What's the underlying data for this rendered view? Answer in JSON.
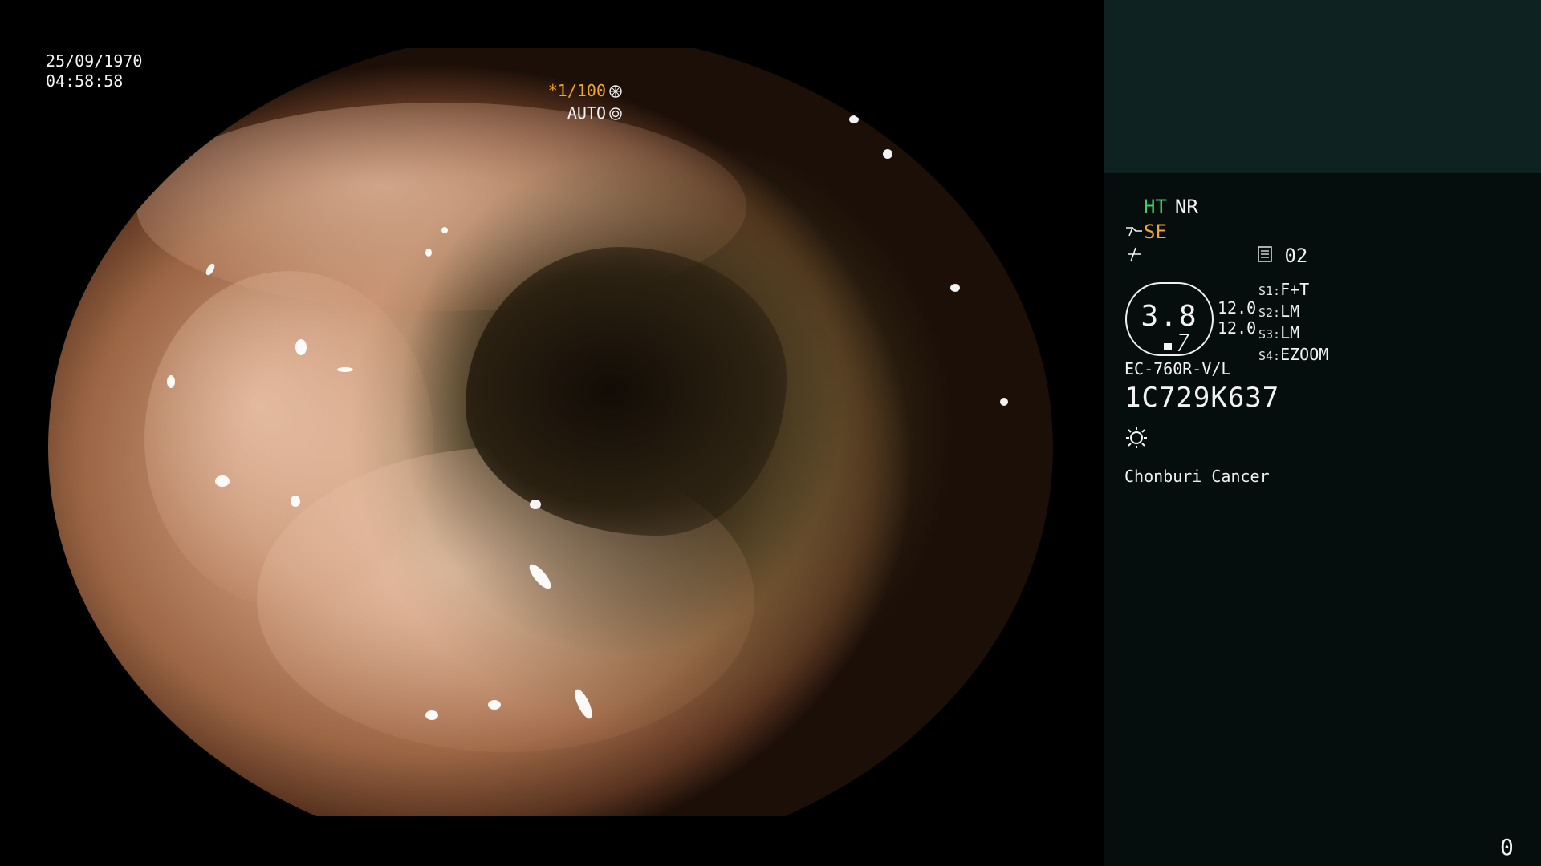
{
  "overlay": {
    "date": "25/09/1970",
    "time": "04:58:58",
    "shutter_speed": "*1/100",
    "shutter_mode": "AUTO"
  },
  "panel": {
    "ht_label": "HT",
    "nr_label": "NR",
    "se_label": "SE",
    "preset_number": "02",
    "gauge_value": "3.8",
    "values": [
      "12.0",
      "12.0"
    ],
    "switches": [
      {
        "key": "S1:",
        "value": "F+T"
      },
      {
        "key": "S2:",
        "value": "LM"
      },
      {
        "key": "S3:",
        "value": "LM"
      },
      {
        "key": "S4:",
        "value": "EZOOM"
      }
    ],
    "scope_model": "EC-760R-V/L",
    "serial_number": "1C729K637",
    "site_name": "Chonburi Cancer",
    "image_counter": "0"
  },
  "colors": {
    "ht": "#3fd06a",
    "se": "#f0a72c",
    "shutter": "#f0a72c",
    "panel_top": "#0e2222",
    "panel_body": "#050e0d"
  },
  "icons": [
    "aperture-icon",
    "iris-icon",
    "scope-tip-icon",
    "enhance-icon",
    "preset-memo-icon",
    "light-icon"
  ]
}
